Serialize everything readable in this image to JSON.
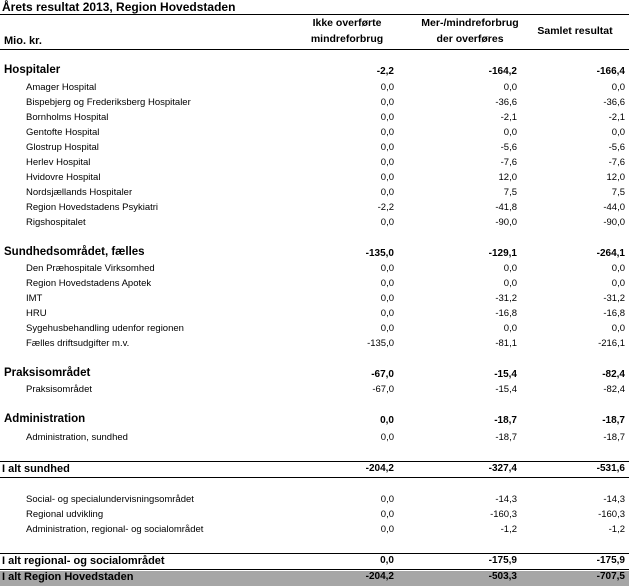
{
  "title": "Årets resultat 2013, Region Hovedstaden",
  "headers": {
    "unit": "Mio. kr.",
    "col1": [
      "Ikke overførte",
      "mindreforbrug"
    ],
    "col2": [
      "Mer-/mindreforbrug",
      "der overføres"
    ],
    "col3": "Samlet resultat"
  },
  "rows": [
    {
      "type": "sec",
      "label": "Hospitaler",
      "v1": "-2,2",
      "v2": "-164,2",
      "v3": "-166,4"
    },
    {
      "type": "item",
      "label": "Amager Hospital",
      "v1": "0,0",
      "v2": "0,0",
      "v3": "0,0"
    },
    {
      "type": "item",
      "label": "Bispebjerg og Frederiksberg Hospitaler",
      "v1": "0,0",
      "v2": "-36,6",
      "v3": "-36,6"
    },
    {
      "type": "item",
      "label": "Bornholms Hospital",
      "v1": "0,0",
      "v2": "-2,1",
      "v3": "-2,1"
    },
    {
      "type": "item",
      "label": "Gentofte Hospital",
      "v1": "0,0",
      "v2": "0,0",
      "v3": "0,0"
    },
    {
      "type": "item",
      "label": "Glostrup Hospital",
      "v1": "0,0",
      "v2": "-5,6",
      "v3": "-5,6"
    },
    {
      "type": "item",
      "label": "Herlev Hospital",
      "v1": "0,0",
      "v2": "-7,6",
      "v3": "-7,6"
    },
    {
      "type": "item",
      "label": "Hvidovre Hospital",
      "v1": "0,0",
      "v2": "12,0",
      "v3": "12,0"
    },
    {
      "type": "item",
      "label": "Nordsjællands Hospitaler",
      "v1": "0,0",
      "v2": "7,5",
      "v3": "7,5"
    },
    {
      "type": "item",
      "label": "Region Hovedstadens Psykiatri",
      "v1": "-2,2",
      "v2": "-41,8",
      "v3": "-44,0"
    },
    {
      "type": "item",
      "label": "Rigshospitalet",
      "v1": "0,0",
      "v2": "-90,0",
      "v3": "-90,0"
    },
    {
      "type": "sec",
      "label": "Sundhedsområdet, fælles",
      "v1": "-135,0",
      "v2": "-129,1",
      "v3": "-264,1"
    },
    {
      "type": "item",
      "label": "Den Præhospitale Virksomhed",
      "v1": "0,0",
      "v2": "0,0",
      "v3": "0,0"
    },
    {
      "type": "item",
      "label": "Region Hovedstadens Apotek",
      "v1": "0,0",
      "v2": "0,0",
      "v3": "0,0"
    },
    {
      "type": "item",
      "label": "IMT",
      "v1": "0,0",
      "v2": "-31,2",
      "v3": "-31,2"
    },
    {
      "type": "item",
      "label": "HRU",
      "v1": "0,0",
      "v2": "-16,8",
      "v3": "-16,8"
    },
    {
      "type": "item",
      "label": "Sygehusbehandling udenfor regionen",
      "v1": "0,0",
      "v2": "0,0",
      "v3": "0,0"
    },
    {
      "type": "item",
      "label": "Fælles driftsudgifter m.v.",
      "v1": "-135,0",
      "v2": "-81,1",
      "v3": "-216,1"
    },
    {
      "type": "sec",
      "label": "Praksisområdet",
      "v1": "-67,0",
      "v2": "-15,4",
      "v3": "-82,4"
    },
    {
      "type": "item",
      "label": "Praksisområdet",
      "v1": "-67,0",
      "v2": "-15,4",
      "v3": "-82,4"
    },
    {
      "type": "sec",
      "label": "Administration",
      "v1": "0,0",
      "v2": "-18,7",
      "v3": "-18,7"
    },
    {
      "type": "item",
      "label": "Administration, sundhed",
      "v1": "0,0",
      "v2": "-18,7",
      "v3": "-18,7"
    },
    {
      "type": "total",
      "label": "I alt sundhed",
      "v1": "-204,2",
      "v2": "-327,4",
      "v3": "-531,6"
    },
    {
      "type": "item",
      "label": "Social- og specialundervisningsområdet",
      "v1": "0,0",
      "v2": "-14,3",
      "v3": "-14,3"
    },
    {
      "type": "item",
      "label": "Regional udvikling",
      "v1": "0,0",
      "v2": "-160,3",
      "v3": "-160,3"
    },
    {
      "type": "item",
      "label": "Administration, regional- og socialområdet",
      "v1": "0,0",
      "v2": "-1,2",
      "v3": "-1,2"
    },
    {
      "type": "total",
      "label": "I alt regional- og socialområdet",
      "v1": "0,0",
      "v2": "-175,9",
      "v3": "-175,9"
    },
    {
      "type": "grand",
      "label": "I alt Region Hovedstaden",
      "v1": "-204,2",
      "v2": "-503,3",
      "v3": "-707,5"
    }
  ]
}
